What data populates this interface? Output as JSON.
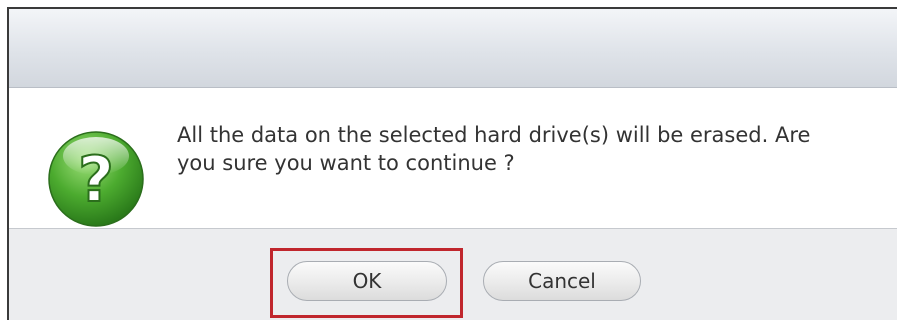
{
  "dialog": {
    "message": "All the data on the selected hard drive(s) will be erased. Are you sure you want to continue ?",
    "icon": "question-icon",
    "icon_glyph": "?",
    "colors": {
      "icon_green": "#3c9a2a",
      "highlight_red": "#c0262d"
    }
  },
  "buttons": {
    "ok_label": "OK",
    "cancel_label": "Cancel"
  }
}
